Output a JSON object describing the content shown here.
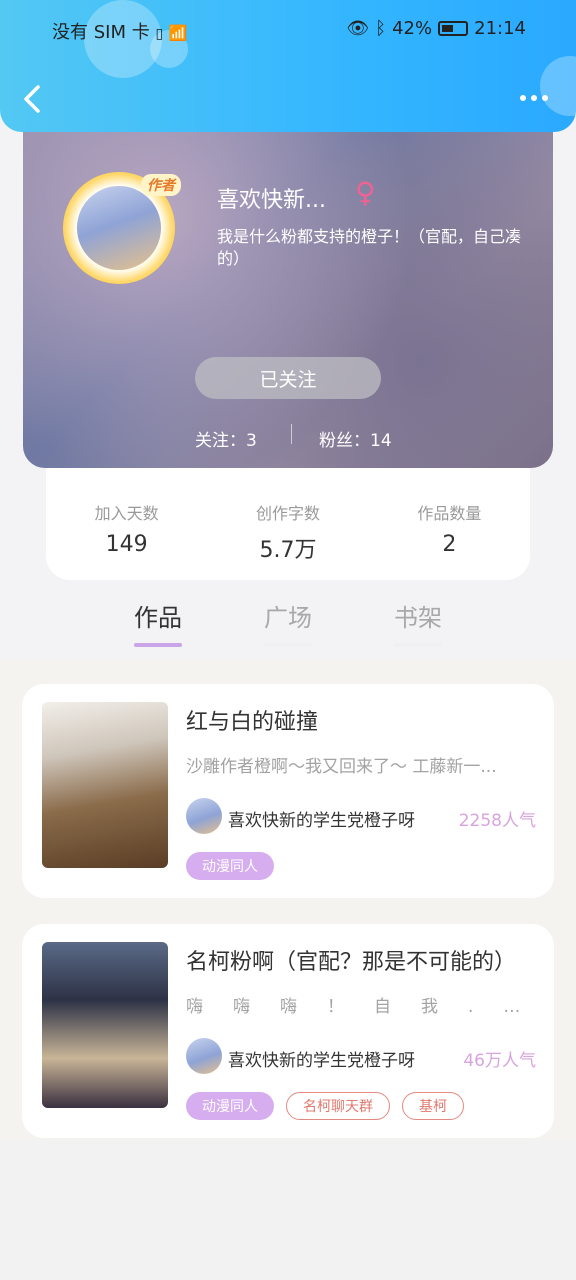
{
  "status_bar": {
    "carrier": "没有 SIM 卡",
    "battery": "42%",
    "time": "21:14"
  },
  "profile": {
    "author_badge": "作者",
    "username": "喜欢快新...",
    "gender_symbol": "♀",
    "bio": "我是什么粉都支持的橙子！（官配，自己凑的）",
    "follow_button": "已关注",
    "following": "关注：3",
    "followers": "粉丝：14"
  },
  "stats": [
    {
      "label": "加入天数",
      "value": "149"
    },
    {
      "label": "创作字数",
      "value": "5.7万"
    },
    {
      "label": "作品数量",
      "value": "2"
    }
  ],
  "tabs": [
    {
      "label": "作品",
      "active": true
    },
    {
      "label": "广场",
      "active": false
    },
    {
      "label": "书架",
      "active": false
    }
  ],
  "works": [
    {
      "title": "红与白的碰撞",
      "desc": "沙雕作者橙啊～我又回来了～ 工藤新一...",
      "author": "喜欢快新的学生党橙子呀",
      "popularity": "2258人气",
      "tags": [
        {
          "label": "动漫同人",
          "style": "fill"
        }
      ]
    },
    {
      "title": "名柯粉啊（官配？那是不可能的）",
      "desc": "嗨嗨嗨！自我...",
      "author": "喜欢快新的学生党橙子呀",
      "popularity": "46万人气",
      "tags": [
        {
          "label": "动漫同人",
          "style": "fill"
        },
        {
          "label": "名柯聊天群",
          "style": "outline"
        },
        {
          "label": "基柯",
          "style": "outline"
        }
      ]
    }
  ],
  "colors": {
    "header_blue": "#34b6ff",
    "accent_purple": "#c9a5e8",
    "popularity_pink": "#d8a4dd",
    "tag_outline_red": "#e07a6f"
  }
}
